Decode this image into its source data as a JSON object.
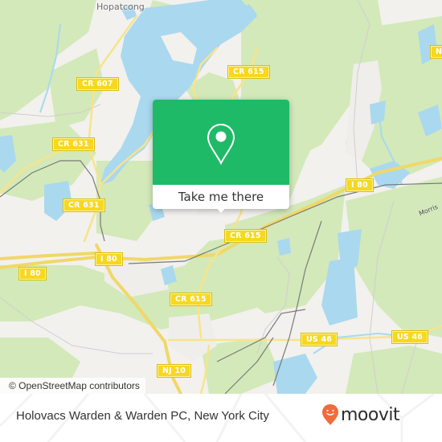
{
  "map": {
    "provider": "OpenStreetMap",
    "colors": {
      "land": "#f2f1ee",
      "forest": "#d3e9b9",
      "water": "#aad8ef",
      "road_major": "#f6e27a",
      "rail": "#777777",
      "shield_fill": "#f6d81f"
    },
    "place_labels": [
      {
        "name": "Hopatcong"
      }
    ],
    "water_labels": [
      {
        "name": "Morris"
      }
    ],
    "road_shields": [
      {
        "label": "CR 607"
      },
      {
        "label": "CR 615"
      },
      {
        "label": "CR 631"
      },
      {
        "label": "CR 631"
      },
      {
        "label": "I 80"
      },
      {
        "label": "I 80"
      },
      {
        "label": "I 80"
      },
      {
        "label": "CR 615"
      },
      {
        "label": "CR 615"
      },
      {
        "label": "US 46"
      },
      {
        "label": "US 46"
      },
      {
        "label": "NJ 10"
      },
      {
        "label": "N"
      }
    ],
    "attribution": "© OpenStreetMap contributors"
  },
  "popup": {
    "icon": "map-pin-icon",
    "cta_label": "Take me there",
    "accent_color": "#1fba67"
  },
  "footer": {
    "place_title": "Holovacs Warden & Warden PC, New York City",
    "brand": "moovit",
    "brand_color": "#f26b3a"
  }
}
